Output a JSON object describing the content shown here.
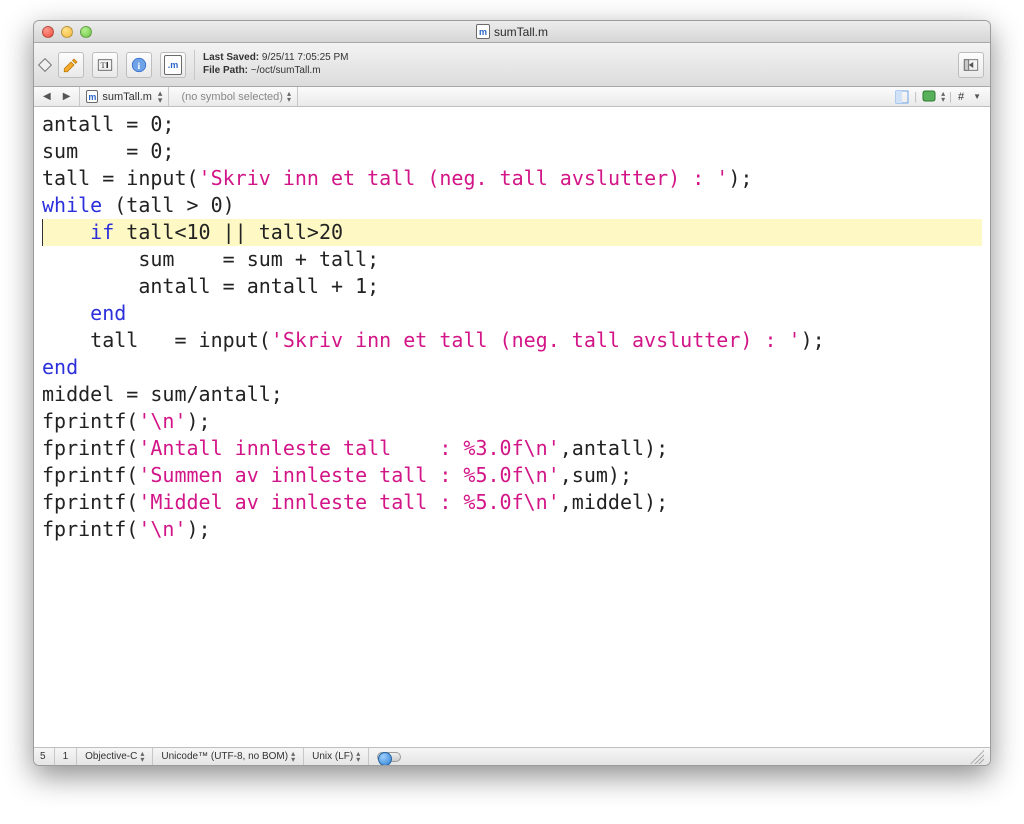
{
  "window": {
    "title": "sumTall.m",
    "doc_letter": "m"
  },
  "toolbar": {
    "last_saved_label": "Last Saved:",
    "last_saved_value": "9/25/11 7:05:25 PM",
    "file_path_label": "File Path:",
    "file_path_value": "~/oct/sumTall.m"
  },
  "navbar": {
    "filename": "sumTall.m",
    "symbol_text": "(no symbol selected)"
  },
  "code": {
    "tokens": [
      [
        {
          "t": "antall = 0;",
          "c": ""
        }
      ],
      [
        {
          "t": "sum    = 0;",
          "c": ""
        }
      ],
      [
        {
          "t": "tall = input(",
          "c": ""
        },
        {
          "t": "'Skriv inn et tall (neg. tall avslutter) : '",
          "c": "str"
        },
        {
          "t": ");",
          "c": ""
        }
      ],
      [
        {
          "t": "while",
          "c": "kw"
        },
        {
          "t": " (tall > 0)",
          "c": ""
        }
      ],
      {
        "hl": true,
        "row": [
          {
            "t": "    ",
            "c": ""
          },
          {
            "t": "if",
            "c": "kw"
          },
          {
            "t": " tall<10 || tall>20",
            "c": ""
          }
        ]
      },
      [
        {
          "t": "        sum    = sum + tall;",
          "c": ""
        }
      ],
      [
        {
          "t": "        antall = antall + 1;",
          "c": ""
        }
      ],
      [
        {
          "t": "    ",
          "c": ""
        },
        {
          "t": "end",
          "c": "kw"
        }
      ],
      [
        {
          "t": "    tall   = input(",
          "c": ""
        },
        {
          "t": "'Skriv inn et tall (neg. tall avslutter) : '",
          "c": "str"
        },
        {
          "t": ");",
          "c": ""
        }
      ],
      [
        {
          "t": "end",
          "c": "kw"
        }
      ],
      [
        {
          "t": "middel = sum/antall;",
          "c": ""
        }
      ],
      [
        {
          "t": "fprintf(",
          "c": ""
        },
        {
          "t": "'\\n'",
          "c": "str"
        },
        {
          "t": ");",
          "c": ""
        }
      ],
      [
        {
          "t": "fprintf(",
          "c": ""
        },
        {
          "t": "'Antall innleste tall    : %3.0f\\n'",
          "c": "str"
        },
        {
          "t": ",antall);",
          "c": ""
        }
      ],
      [
        {
          "t": "fprintf(",
          "c": ""
        },
        {
          "t": "'Summen av innleste tall : %5.0f\\n'",
          "c": "str"
        },
        {
          "t": ",sum);",
          "c": ""
        }
      ],
      [
        {
          "t": "fprintf(",
          "c": ""
        },
        {
          "t": "'Middel av innleste tall : %5.0f\\n'",
          "c": "str"
        },
        {
          "t": ",middel);",
          "c": ""
        }
      ],
      [
        {
          "t": "fprintf(",
          "c": ""
        },
        {
          "t": "'\\n'",
          "c": "str"
        },
        {
          "t": ");",
          "c": ""
        }
      ]
    ]
  },
  "status": {
    "line": "5",
    "col": "1",
    "language": "Objective-C",
    "encoding": "Unicode™ (UTF-8, no BOM)",
    "line_endings": "Unix (LF)",
    "hash": "#"
  }
}
